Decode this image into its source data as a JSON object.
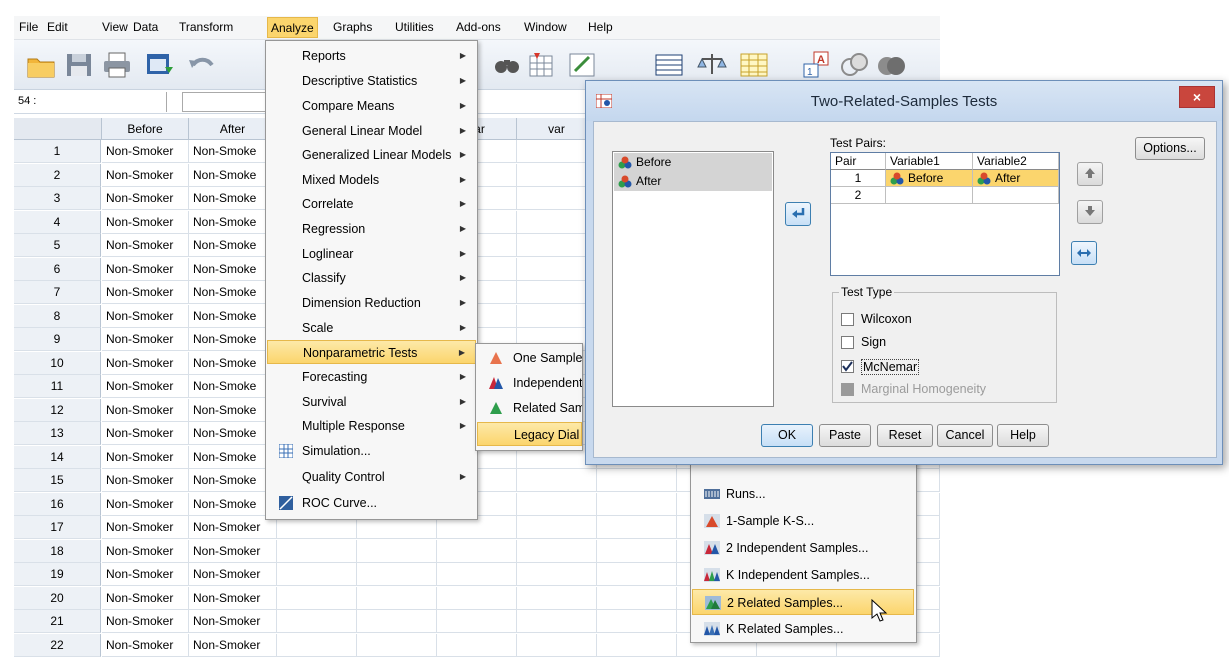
{
  "menubar": {
    "items": [
      "File",
      "Edit",
      "View",
      "Data",
      "Transform",
      "Analyze",
      "Graphs",
      "Utilities",
      "Add-ons",
      "Window",
      "Help"
    ]
  },
  "cellbar": {
    "ref": "54 :"
  },
  "grid": {
    "headers": [
      "Before",
      "After",
      "var",
      "var"
    ],
    "rows": [
      {
        "n": "1",
        "before": "Non-Smoker",
        "after": "Non-Smoke"
      },
      {
        "n": "2",
        "before": "Non-Smoker",
        "after": "Non-Smoke"
      },
      {
        "n": "3",
        "before": "Non-Smoker",
        "after": "Non-Smoke"
      },
      {
        "n": "4",
        "before": "Non-Smoker",
        "after": "Non-Smoke"
      },
      {
        "n": "5",
        "before": "Non-Smoker",
        "after": "Non-Smoke"
      },
      {
        "n": "6",
        "before": "Non-Smoker",
        "after": "Non-Smoke"
      },
      {
        "n": "7",
        "before": "Non-Smoker",
        "after": "Non-Smoke"
      },
      {
        "n": "8",
        "before": "Non-Smoker",
        "after": "Non-Smoke"
      },
      {
        "n": "9",
        "before": "Non-Smoker",
        "after": "Non-Smoke"
      },
      {
        "n": "10",
        "before": "Non-Smoker",
        "after": "Non-Smoke"
      },
      {
        "n": "11",
        "before": "Non-Smoker",
        "after": "Non-Smoke"
      },
      {
        "n": "12",
        "before": "Non-Smoker",
        "after": "Non-Smoke"
      },
      {
        "n": "13",
        "before": "Non-Smoker",
        "after": "Non-Smoke"
      },
      {
        "n": "14",
        "before": "Non-Smoker",
        "after": "Non-Smoke"
      },
      {
        "n": "15",
        "before": "Non-Smoker",
        "after": "Non-Smoke"
      },
      {
        "n": "16",
        "before": "Non-Smoker",
        "after": "Non-Smoke"
      },
      {
        "n": "17",
        "before": "Non-Smoker",
        "after": "Non-Smoker"
      },
      {
        "n": "18",
        "before": "Non-Smoker",
        "after": "Non-Smoker"
      },
      {
        "n": "19",
        "before": "Non-Smoker",
        "after": "Non-Smoker"
      },
      {
        "n": "20",
        "before": "Non-Smoker",
        "after": "Non-Smoker"
      },
      {
        "n": "21",
        "before": "Non-Smoker",
        "after": "Non-Smoker"
      },
      {
        "n": "22",
        "before": "Non-Smoker",
        "after": "Non-Smoker"
      }
    ]
  },
  "analyze_menu": {
    "items": [
      "Reports",
      "Descriptive Statistics",
      "Compare Means",
      "General Linear Model",
      "Generalized Linear Models",
      "Mixed Models",
      "Correlate",
      "Regression",
      "Loglinear",
      "Classify",
      "Dimension Reduction",
      "Scale",
      "Nonparametric Tests",
      "Forecasting",
      "Survival",
      "Multiple Response",
      "Simulation...",
      "Quality Control",
      "ROC Curve..."
    ]
  },
  "nonparametric_menu": {
    "items": [
      "One Sample",
      "Independent",
      "Related Sam",
      "Legacy Dial"
    ]
  },
  "legacy_menu": {
    "items": [
      "Runs...",
      "1-Sample K-S...",
      "2 Independent Samples...",
      "K Independent Samples...",
      "2 Related Samples...",
      "K Related Samples..."
    ]
  },
  "dialog": {
    "title": "Two-Related-Samples Tests",
    "close": "×",
    "variables": [
      "Before",
      "After"
    ],
    "test_pairs_label": "Test Pairs:",
    "pairs_headers": [
      "Pair",
      "Variable1",
      "Variable2"
    ],
    "pairs_rows": [
      {
        "pair": "1",
        "v1": "Before",
        "v2": "After"
      },
      {
        "pair": "2",
        "v1": "",
        "v2": ""
      }
    ],
    "options_button": "Options...",
    "test_type_label": "Test Type",
    "tests": [
      {
        "label": "Wilcoxon",
        "checked": false,
        "enabled": true
      },
      {
        "label": "Sign",
        "checked": false,
        "enabled": true
      },
      {
        "label": "McNemar",
        "checked": true,
        "enabled": true
      },
      {
        "label": "Marginal Homogeneity",
        "checked": false,
        "enabled": false
      }
    ],
    "buttons": [
      "OK",
      "Paste",
      "Reset",
      "Cancel",
      "Help"
    ]
  },
  "colors": {
    "highlight": "#fbd56d",
    "dialog_frame": "#c8d9ee",
    "grid_header": "#e9eef5"
  }
}
